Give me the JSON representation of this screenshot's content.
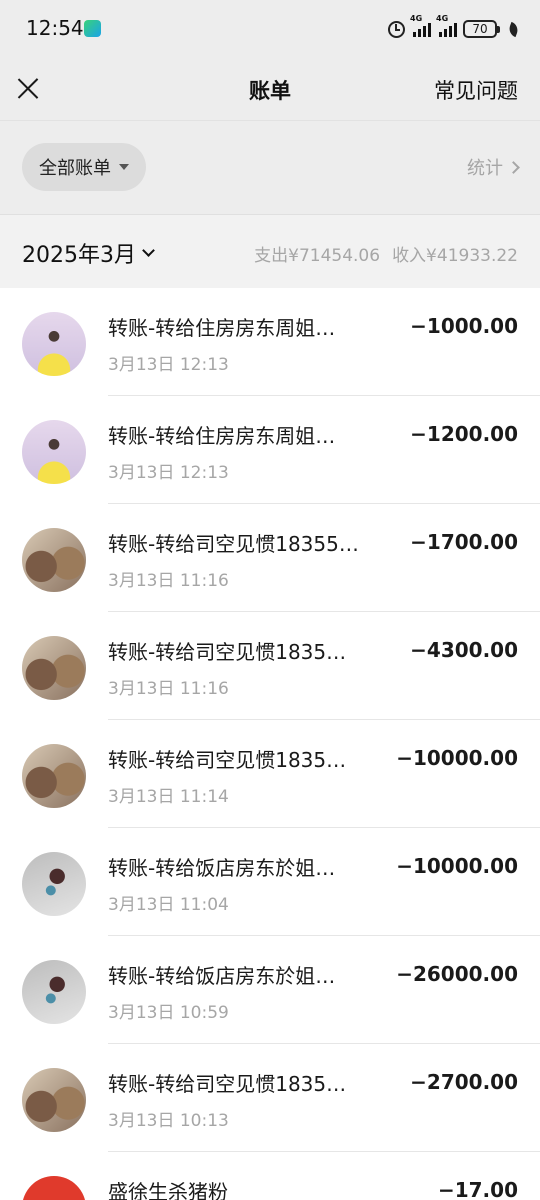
{
  "status_bar": {
    "time": "12:54",
    "network_1": "4G",
    "network_2": "4G",
    "battery": "70"
  },
  "nav": {
    "title": "账单",
    "faq_label": "常见问题"
  },
  "filter": {
    "bill_type": "全部账单",
    "stats_label": "统计"
  },
  "month": {
    "label": "2025年3月",
    "expense": "支出¥71454.06",
    "income": "收入¥41933.22"
  },
  "transactions": [
    {
      "title": "转账-转给住房房东周姐…",
      "time": "3月13日 12:13",
      "amount": "−1000.00",
      "avatar": "person"
    },
    {
      "title": "转账-转给住房房东周姐…",
      "time": "3月13日 12:13",
      "amount": "−1200.00",
      "avatar": "person"
    },
    {
      "title": "转账-转给司空见惯18355…",
      "time": "3月13日 11:16",
      "amount": "−1700.00",
      "avatar": "dogs"
    },
    {
      "title": "转账-转给司空见惯1835…",
      "time": "3月13日 11:16",
      "amount": "−4300.00",
      "avatar": "dogs"
    },
    {
      "title": "转账-转给司空见惯1835…",
      "time": "3月13日 11:14",
      "amount": "−10000.00",
      "avatar": "dogs"
    },
    {
      "title": "转账-转给饭店房东於姐…",
      "time": "3月13日 11:04",
      "amount": "−10000.00",
      "avatar": "flower"
    },
    {
      "title": "转账-转给饭店房东於姐…",
      "time": "3月13日 10:59",
      "amount": "−26000.00",
      "avatar": "flower"
    },
    {
      "title": "转账-转给司空见惯1835…",
      "time": "3月13日 10:13",
      "amount": "−2700.00",
      "avatar": "dogs"
    },
    {
      "title": "盛徐生杀猪粉",
      "time": "",
      "amount": "−17.00",
      "avatar": "shop"
    }
  ]
}
